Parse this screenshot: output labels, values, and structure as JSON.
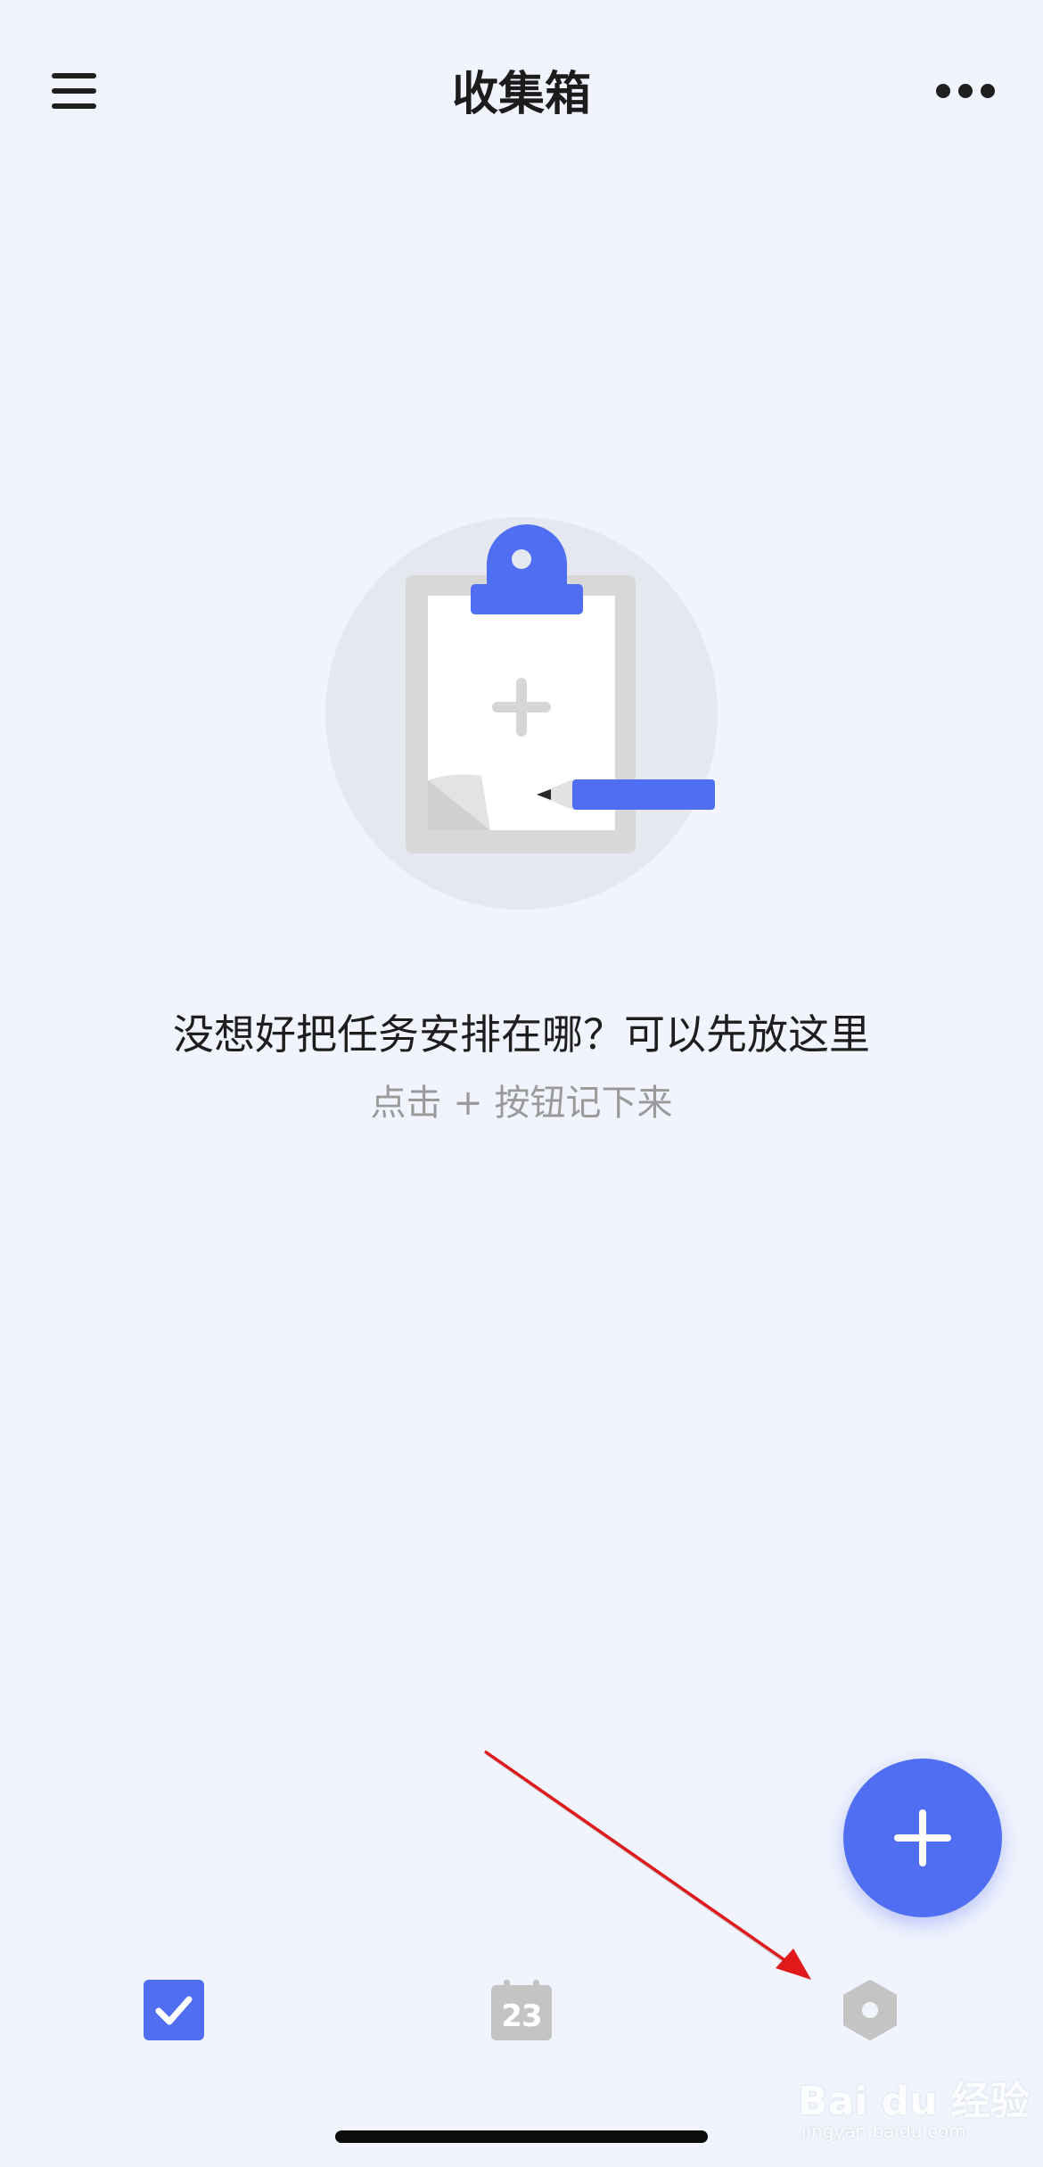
{
  "header": {
    "title": "收集箱",
    "menu_icon": "hamburger-menu-icon",
    "more_icon": "more-dots-icon"
  },
  "empty_state": {
    "illustration_icon": "clipboard-pencil-icon",
    "title": "没想好把任务安排在哪？可以先放这里",
    "hint": "点击 + 按钮记下来"
  },
  "fab": {
    "icon": "plus-icon",
    "color": "#4f6ef2"
  },
  "tabs": [
    {
      "name": "tasks",
      "icon": "checkbox-icon",
      "active": true
    },
    {
      "name": "calendar",
      "icon": "calendar-icon",
      "label": "23",
      "active": false
    },
    {
      "name": "habit",
      "icon": "hexagon-icon",
      "active": false
    }
  ],
  "colors": {
    "background": "#f1f4fd",
    "accent": "#4f6ef2",
    "inactive_icon": "#c4c4c4",
    "annotation_arrow": "#e0191b"
  },
  "watermark": {
    "brand": "Bai du 经验",
    "url": "jingyan.baidu.com"
  }
}
